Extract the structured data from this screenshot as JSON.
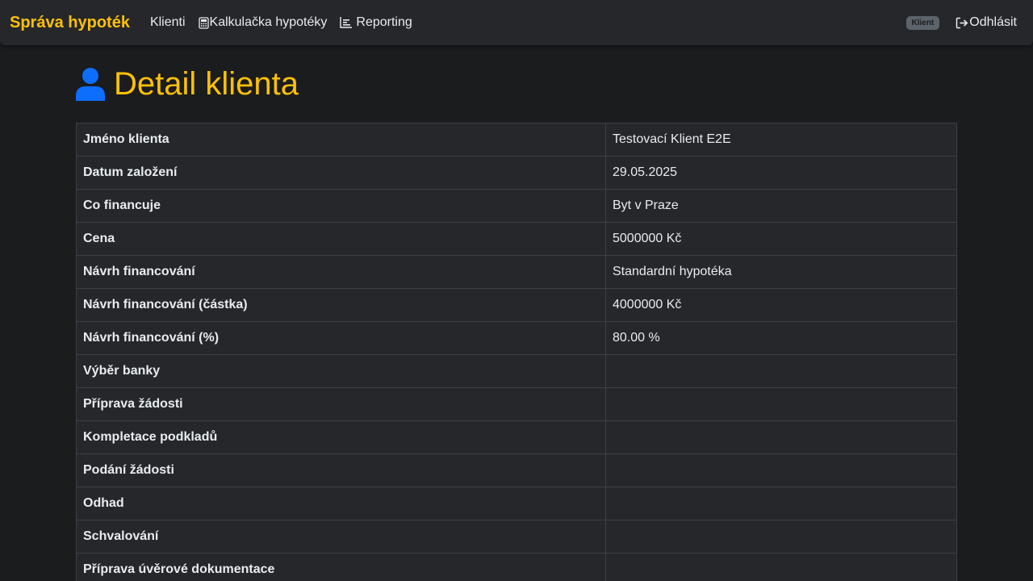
{
  "navbar": {
    "brand": "Správa hypoték",
    "links": [
      {
        "label": "Klienti",
        "icon": ""
      },
      {
        "label": "Kalkulačka hypotéky",
        "icon": "calculator-icon"
      },
      {
        "label": "Reporting",
        "icon": "bar-chart-icon"
      }
    ],
    "role_badge": "Klient",
    "logout_label": "Odhlásit",
    "logout_icon": "logout-icon"
  },
  "page": {
    "title": "Detail klienta",
    "title_icon": "user-icon"
  },
  "colors": {
    "accent": "#ffc107",
    "icon_blue": "#0d6efd",
    "background": "#1b1c1e",
    "navbar_bg": "#25272b"
  },
  "client_details": [
    {
      "label": "Jméno klienta",
      "value": "Testovací Klient E2E"
    },
    {
      "label": "Datum založení",
      "value": "29.05.2025"
    },
    {
      "label": "Co financuje",
      "value": "Byt v Praze"
    },
    {
      "label": "Cena",
      "value": "5000000 Kč"
    },
    {
      "label": "Návrh financování",
      "value": "Standardní hypotéka"
    },
    {
      "label": "Návrh financování (částka)",
      "value": "4000000 Kč"
    },
    {
      "label": "Návrh financování (%)",
      "value": "80.00 %"
    },
    {
      "label": "Výběr banky",
      "value": ""
    },
    {
      "label": "Příprava žádosti",
      "value": ""
    },
    {
      "label": "Kompletace podkladů",
      "value": ""
    },
    {
      "label": "Podání žádosti",
      "value": ""
    },
    {
      "label": "Odhad",
      "value": ""
    },
    {
      "label": "Schvalování",
      "value": ""
    },
    {
      "label": "Příprava úvěrové dokumentace",
      "value": ""
    }
  ]
}
